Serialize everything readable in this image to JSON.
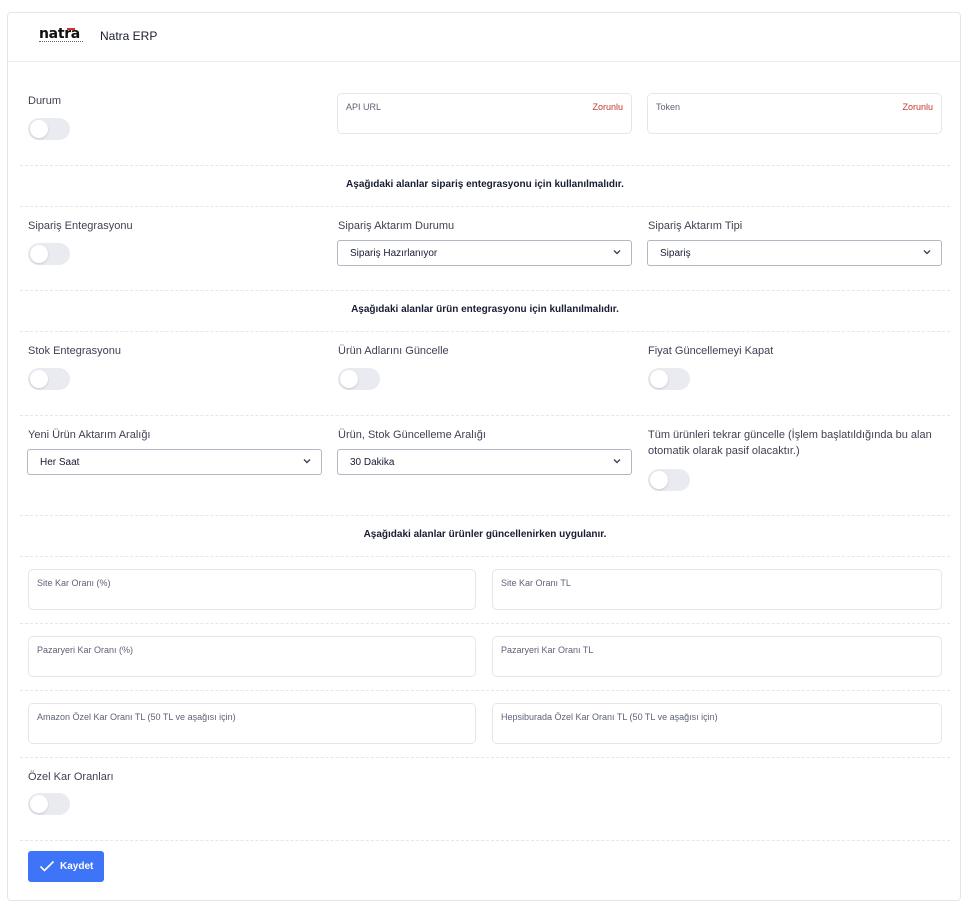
{
  "header": {
    "logo_text": "natra",
    "logo_subtext": "Technology Software",
    "title": "Natra ERP"
  },
  "general": {
    "status_label": "Durum",
    "api_url": {
      "label": "API URL",
      "required": "Zorunlu",
      "value": ""
    },
    "token": {
      "label": "Token",
      "required": "Zorunlu",
      "value": ""
    }
  },
  "order_section": {
    "title": "Aşağıdaki alanlar sipariş entegrasyonu için kullanılmalıdır.",
    "integration_label": "Sipariş Entegrasyonu",
    "transfer_status": {
      "label": "Sipariş Aktarım Durumu",
      "value": "Sipariş Hazırlanıyor"
    },
    "transfer_type": {
      "label": "Sipariş Aktarım Tipi",
      "value": "Sipariş"
    }
  },
  "product_section": {
    "title": "Aşağıdaki alanlar ürün entegrasyonu için kullanılmalıdır.",
    "stock_integration_label": "Stok Entegrasyonu",
    "update_names_label": "Ürün Adlarını Güncelle",
    "disable_price_update_label": "Fiyat Güncellemeyi Kapat",
    "new_product_interval": {
      "label": "Yeni Ürün Aktarım Aralığı",
      "value": "Her Saat"
    },
    "stock_update_interval": {
      "label": "Ürün, Stok Güncelleme Aralığı",
      "value": "30 Dakika"
    },
    "update_all_label": "Tüm ürünleri tekrar güncelle (İşlem başlatıldığında bu alan otomatik olarak pasif olacaktır.)"
  },
  "pricing_section": {
    "title": "Aşağıdaki alanlar ürünler güncellenirken uygulanır.",
    "site_margin_pct": "Site Kar Oranı (%)",
    "site_margin_tl": "Site Kar Oranı TL",
    "marketplace_margin_pct": "Pazaryeri Kar Oranı (%)",
    "marketplace_margin_tl": "Pazaryeri Kar Oranı TL",
    "amazon_margin": "Amazon Özel Kar Oranı TL (50 TL ve aşağısı için)",
    "hepsiburada_margin": "Hepsiburada Özel Kar Oranı TL (50 TL ve aşağısı için)",
    "custom_margins_label": "Özel Kar Oranları"
  },
  "actions": {
    "save_label": "Kaydet"
  },
  "colors": {
    "primary": "#3e74f7",
    "required": "#c0392b",
    "toggle_off": "#e9ebf1"
  }
}
